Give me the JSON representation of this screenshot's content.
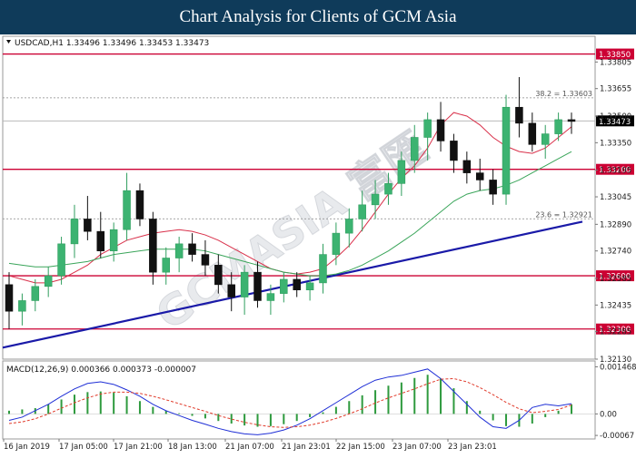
{
  "banner": {
    "title": "Chart Analysis for Clients of GCM Asia"
  },
  "chart_data": [
    {
      "type": "candlestick",
      "symbol_header": "USDCAD,H1  1.33496 1.33496 1.33453 1.33473",
      "ylim": [
        1.3213,
        1.3395
      ],
      "y_ticks": [
        "1.33805",
        "1.33655",
        "1.33500",
        "1.33350",
        "1.33195",
        "1.33045",
        "1.32890",
        "1.32740",
        "1.32585",
        "1.32435",
        "1.32285",
        "1.32130"
      ],
      "x_ticks": [
        "16 Jan 2019",
        "17 Jan 05:00",
        "17 Jan 21:00",
        "18 Jan 13:00",
        "21 Jan 07:00",
        "21 Jan 23:01",
        "22 Jan 15:00",
        "23 Jan 07:00",
        "23 Jan 23:01"
      ],
      "current_price": "1.33473",
      "horizontal_levels": [
        {
          "value": 1.3385,
          "label": "1.33850",
          "color": "#cc0033"
        },
        {
          "value": 1.332,
          "label": "1.33200",
          "color": "#cc0033"
        },
        {
          "value": 1.326,
          "label": "1.32600",
          "color": "#cc0033"
        },
        {
          "value": 1.323,
          "label": "1.32300",
          "color": "#cc0033"
        }
      ],
      "fib_levels": [
        {
          "value": 1.33603,
          "label": "38.2 = 1.33603"
        },
        {
          "value": 1.32921,
          "label": "23.6 = 1.32921"
        }
      ],
      "trendline": {
        "from_bar": 0,
        "from_value": 1.32195,
        "to_bar": 104,
        "to_value": 1.32905,
        "color": "#1a1aa8"
      },
      "moving_averages": [
        {
          "color": "#d9304a",
          "values": [
            1.326,
            1.3258,
            1.3256,
            1.3256,
            1.3258,
            1.3262,
            1.3266,
            1.3272,
            1.3276,
            1.328,
            1.3282,
            1.3284,
            1.3285,
            1.3286,
            1.3285,
            1.3283,
            1.328,
            1.3276,
            1.3272,
            1.3268,
            1.3264,
            1.3262,
            1.3261,
            1.3262,
            1.3264,
            1.327,
            1.3277,
            1.3286,
            1.3296,
            1.3306,
            1.3315,
            1.3322,
            1.3332,
            1.3345,
            1.3352,
            1.335,
            1.3345,
            1.3338,
            1.3333,
            1.333,
            1.3329,
            1.3332,
            1.3338,
            1.3344
          ]
        },
        {
          "color": "#3aa55a",
          "values": [
            1.3267,
            1.3266,
            1.3265,
            1.3265,
            1.3266,
            1.3267,
            1.3268,
            1.327,
            1.3272,
            1.3273,
            1.3274,
            1.3275,
            1.3275,
            1.3275,
            1.3275,
            1.3274,
            1.3272,
            1.327,
            1.3268,
            1.3266,
            1.3264,
            1.3262,
            1.3261,
            1.326,
            1.326,
            1.3261,
            1.3263,
            1.3266,
            1.327,
            1.3274,
            1.3279,
            1.3284,
            1.329,
            1.3296,
            1.3302,
            1.3306,
            1.3308,
            1.3309,
            1.3311,
            1.3314,
            1.3318,
            1.3322,
            1.3326,
            1.333
          ]
        }
      ],
      "candles": [
        [
          1.3255,
          1.3262,
          1.323,
          1.324
        ],
        [
          1.324,
          1.325,
          1.3232,
          1.3246
        ],
        [
          1.3246,
          1.3258,
          1.324,
          1.3254
        ],
        [
          1.3254,
          1.3265,
          1.3248,
          1.326
        ],
        [
          1.326,
          1.3282,
          1.3255,
          1.3278
        ],
        [
          1.3278,
          1.33,
          1.327,
          1.3292
        ],
        [
          1.3292,
          1.3305,
          1.328,
          1.3285
        ],
        [
          1.3285,
          1.3296,
          1.327,
          1.3274
        ],
        [
          1.3274,
          1.329,
          1.3268,
          1.3286
        ],
        [
          1.3286,
          1.3318,
          1.328,
          1.3308
        ],
        [
          1.3308,
          1.3312,
          1.3288,
          1.3292
        ],
        [
          1.3292,
          1.3296,
          1.3255,
          1.3262
        ],
        [
          1.3262,
          1.3276,
          1.3255,
          1.327
        ],
        [
          1.327,
          1.3282,
          1.3262,
          1.3278
        ],
        [
          1.3278,
          1.3284,
          1.3268,
          1.3272
        ],
        [
          1.3272,
          1.328,
          1.326,
          1.3266
        ],
        [
          1.3266,
          1.3272,
          1.325,
          1.3255
        ],
        [
          1.3255,
          1.3262,
          1.324,
          1.3248
        ],
        [
          1.3248,
          1.3266,
          1.3238,
          1.3262
        ],
        [
          1.3262,
          1.3268,
          1.3242,
          1.3246
        ],
        [
          1.3246,
          1.3255,
          1.3238,
          1.325
        ],
        [
          1.325,
          1.3262,
          1.3245,
          1.3258
        ],
        [
          1.3258,
          1.3262,
          1.3248,
          1.3252
        ],
        [
          1.3252,
          1.326,
          1.3246,
          1.3256
        ],
        [
          1.3256,
          1.3278,
          1.325,
          1.3272
        ],
        [
          1.3272,
          1.329,
          1.3266,
          1.3284
        ],
        [
          1.3284,
          1.3298,
          1.3276,
          1.3292
        ],
        [
          1.3292,
          1.3308,
          1.3285,
          1.33
        ],
        [
          1.33,
          1.3314,
          1.3292,
          1.3306
        ],
        [
          1.3306,
          1.3318,
          1.33,
          1.3312
        ],
        [
          1.3312,
          1.333,
          1.3305,
          1.3325
        ],
        [
          1.3325,
          1.3345,
          1.3318,
          1.3338
        ],
        [
          1.3338,
          1.3352,
          1.3325,
          1.3348
        ],
        [
          1.3348,
          1.3358,
          1.333,
          1.3336
        ],
        [
          1.3336,
          1.334,
          1.3318,
          1.3325
        ],
        [
          1.3325,
          1.333,
          1.3312,
          1.3318
        ],
        [
          1.3318,
          1.3326,
          1.3308,
          1.3314
        ],
        [
          1.3314,
          1.332,
          1.33,
          1.3306
        ],
        [
          1.3306,
          1.3362,
          1.33,
          1.3355
        ],
        [
          1.3355,
          1.3372,
          1.3338,
          1.3346
        ],
        [
          1.3346,
          1.3352,
          1.333,
          1.3334
        ],
        [
          1.3334,
          1.3345,
          1.3326,
          1.334
        ],
        [
          1.334,
          1.3352,
          1.3336,
          1.3348
        ],
        [
          1.3348,
          1.3352,
          1.334,
          1.3347
        ]
      ]
    },
    {
      "type": "macd",
      "label": "MACD(12,26,9)  0.000366 0.000373 -0.000007",
      "ylim": [
        -0.00078,
        0.00165
      ],
      "y_ticks": [
        "0.001468",
        "0.00",
        "-0.00067"
      ],
      "histogram": [
        0.0001,
        0.00014,
        0.00018,
        0.0003,
        0.00045,
        0.0006,
        0.00068,
        0.0007,
        0.00066,
        0.00055,
        0.0004,
        0.00022,
        0.0001,
        2e-05,
        -6e-05,
        -0.00014,
        -0.00022,
        -0.0003,
        -0.00036,
        -0.0004,
        -0.00038,
        -0.00032,
        -0.00022,
        -0.0001,
        5e-05,
        0.00022,
        0.0004,
        0.00058,
        0.00074,
        0.00088,
        0.00098,
        0.00112,
        0.00122,
        0.0011,
        0.0008,
        0.0004,
        0.0001,
        -0.0002,
        -0.00038,
        -0.0004,
        -0.0003,
        -0.0001,
        0.0001,
        0.0003
      ],
      "macd_line": [
        -0.0002,
        -0.0001,
        0.0001,
        0.0003,
        0.00055,
        0.00078,
        0.00095,
        0.001,
        0.00092,
        0.00075,
        0.00055,
        0.0003,
        0.0001,
        -5e-05,
        -0.0002,
        -0.00032,
        -0.00045,
        -0.00055,
        -0.00062,
        -0.00065,
        -0.0006,
        -0.0005,
        -0.00035,
        -0.00015,
        0.0001,
        0.00035,
        0.0006,
        0.00085,
        0.00105,
        0.00115,
        0.0012,
        0.0013,
        0.0014,
        0.0011,
        0.0007,
        0.0003,
        -0.0001,
        -0.0004,
        -0.00045,
        -0.0002,
        0.0002,
        0.0003,
        0.00025,
        0.00032
      ],
      "signal_line": [
        -0.0003,
        -0.00025,
        -0.00015,
        0.0,
        0.00018,
        0.00035,
        0.0005,
        0.00062,
        0.00068,
        0.00068,
        0.00064,
        0.00055,
        0.00044,
        0.00032,
        0.0002,
        8e-05,
        -5e-05,
        -0.00016,
        -0.00026,
        -0.00034,
        -0.0004,
        -0.00042,
        -0.0004,
        -0.00035,
        -0.00026,
        -0.00014,
        0.0,
        0.00016,
        0.00034,
        0.0005,
        0.00064,
        0.00078,
        0.00094,
        0.00108,
        0.0011,
        0.001,
        0.00082,
        0.0006,
        0.00036,
        0.00016,
        4e-05,
        8e-05,
        0.00014,
        0.00028
      ]
    }
  ]
}
